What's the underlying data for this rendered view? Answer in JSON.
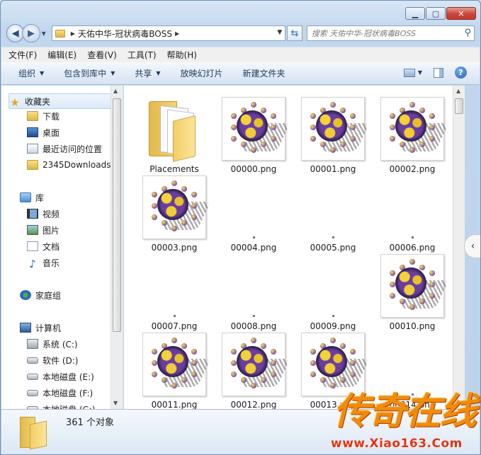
{
  "address": {
    "crumbs": [
      "天佑中华-冠状病毒BOSS"
    ]
  },
  "search": {
    "placeholder": "搜索 天佑中华-冠状病毒BOSS"
  },
  "menu": [
    "文件(F)",
    "编辑(E)",
    "查看(V)",
    "工具(T)",
    "帮助(H)"
  ],
  "toolbar": {
    "organize": "组织",
    "include_library": "包含到库中",
    "share": "共享",
    "slideshow": "放映幻灯片",
    "new_folder": "新建文件夹"
  },
  "sidebar": {
    "favorites": {
      "title": "收藏夹",
      "items": [
        "下载",
        "桌面",
        "最近访问的位置",
        "2345Downloads"
      ]
    },
    "libraries": {
      "title": "库",
      "items": [
        "视频",
        "图片",
        "文档",
        "音乐"
      ]
    },
    "homegroup": "家庭组",
    "computer": {
      "title": "计算机",
      "items": [
        "系统 (C:)",
        "软件 (D:)",
        "本地磁盘 (E:)",
        "本地磁盘 (F:)",
        "本地磁盘 (G:)"
      ]
    }
  },
  "files": [
    {
      "name": "Placements",
      "type": "folder"
    },
    {
      "name": "00000.png",
      "type": "virus"
    },
    {
      "name": "00001.png",
      "type": "virus"
    },
    {
      "name": "00002.png",
      "type": "virus"
    },
    {
      "name": "00003.png",
      "type": "virus"
    },
    {
      "name": "00004.png",
      "type": "blank"
    },
    {
      "name": "00005.png",
      "type": "blank"
    },
    {
      "name": "00006.png",
      "type": "blank"
    },
    {
      "name": "00007.png",
      "type": "blank"
    },
    {
      "name": "00008.png",
      "type": "blank"
    },
    {
      "name": "00009.png",
      "type": "blank"
    },
    {
      "name": "00010.png",
      "type": "virus"
    },
    {
      "name": "00011.png",
      "type": "virus"
    },
    {
      "name": "00012.png",
      "type": "virus"
    },
    {
      "name": "00013.png",
      "type": "virus"
    },
    {
      "name": "00014.png",
      "type": "blank"
    }
  ],
  "status": {
    "count": "361 个对象"
  },
  "watermark": {
    "logo": "传奇在线",
    "url": "www.Xiao163.Com"
  }
}
